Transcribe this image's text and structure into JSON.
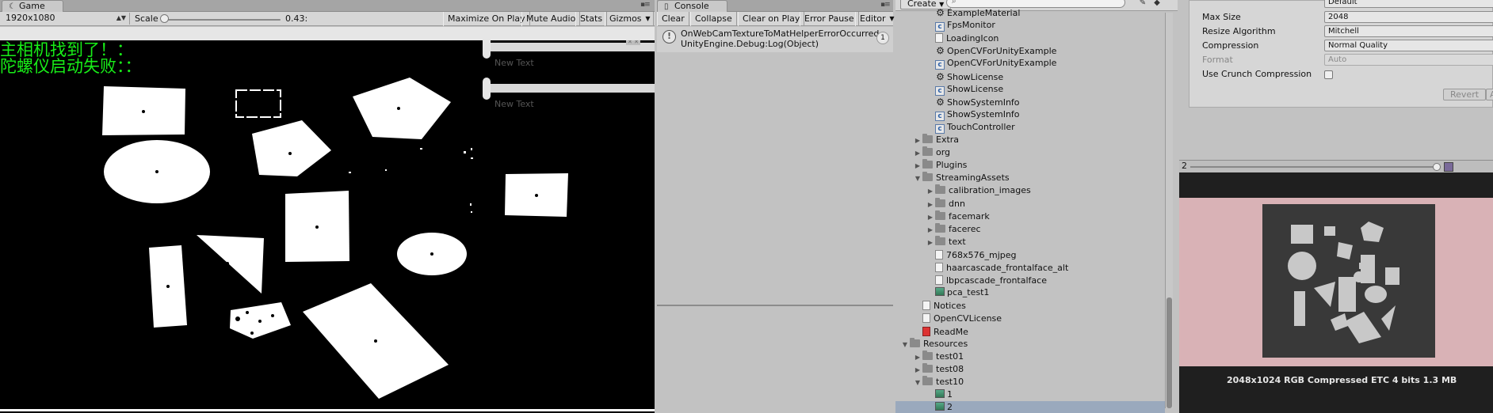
{
  "game": {
    "tab_label": "Game",
    "resolution": "1920x1080",
    "scale_label": "Scale",
    "scale_value": "0.43:",
    "buttons": [
      "Maximize On Play",
      "Mute Audio",
      "Stats",
      "Gizmos"
    ],
    "overlay_lines": [
      "主相机找到了！：",
      "陀螺仪启动失败：："
    ],
    "input_placeholders": [
      "New Text",
      "New Text"
    ]
  },
  "console": {
    "tab_label": "Console",
    "buttons": [
      "Clear",
      "Collapse",
      "Clear on Play",
      "Error Pause",
      "Editor"
    ],
    "entry": {
      "line1": "OnWebCamTextureToMatHelperErrorOccurred",
      "line2": "UnityEngine.Debug:Log(Object)",
      "count": "1"
    }
  },
  "project": {
    "create_label": "Create",
    "search_placeholder": "",
    "rows": [
      {
        "label": "ExampleMaterial",
        "icon": "unity",
        "indent": 2
      },
      {
        "label": "FpsMonitor",
        "icon": "cs",
        "indent": 2
      },
      {
        "label": "LoadingIcon",
        "icon": "file",
        "indent": 2
      },
      {
        "label": "OpenCVForUnityExample",
        "icon": "unity",
        "indent": 2
      },
      {
        "label": "OpenCVForUnityExample",
        "icon": "cs",
        "indent": 2
      },
      {
        "label": "ShowLicense",
        "icon": "unity",
        "indent": 2
      },
      {
        "label": "ShowLicense",
        "icon": "cs",
        "indent": 2
      },
      {
        "label": "ShowSystemInfo",
        "icon": "unity",
        "indent": 2
      },
      {
        "label": "ShowSystemInfo",
        "icon": "cs",
        "indent": 2
      },
      {
        "label": "TouchController",
        "icon": "cs",
        "indent": 2
      },
      {
        "label": "Extra",
        "icon": "folder",
        "indent": 1,
        "arrow": "▶"
      },
      {
        "label": "org",
        "icon": "folder",
        "indent": 1,
        "arrow": "▶"
      },
      {
        "label": "Plugins",
        "icon": "folder",
        "indent": 1,
        "arrow": "▶"
      },
      {
        "label": "StreamingAssets",
        "icon": "folder",
        "indent": 1,
        "arrow": "▼"
      },
      {
        "label": "calibration_images",
        "icon": "folder",
        "indent": 2,
        "arrow": "▶"
      },
      {
        "label": "dnn",
        "icon": "folder",
        "indent": 2,
        "arrow": "▶"
      },
      {
        "label": "facemark",
        "icon": "folder",
        "indent": 2,
        "arrow": "▶"
      },
      {
        "label": "facerec",
        "icon": "folder",
        "indent": 2,
        "arrow": "▶"
      },
      {
        "label": "text",
        "icon": "folder",
        "indent": 2,
        "arrow": "▶"
      },
      {
        "label": "768x576_mjpeg",
        "icon": "file",
        "indent": 2
      },
      {
        "label": "haarcascade_frontalface_alt",
        "icon": "file",
        "indent": 2
      },
      {
        "label": "lbpcascade_frontalface",
        "icon": "file",
        "indent": 2
      },
      {
        "label": "pca_test1",
        "icon": "img",
        "indent": 2
      },
      {
        "label": "Notices",
        "icon": "file",
        "indent": 1
      },
      {
        "label": "OpenCVLicense",
        "icon": "file",
        "indent": 1
      },
      {
        "label": "ReadMe",
        "icon": "pdf",
        "indent": 1
      },
      {
        "label": "Resources",
        "icon": "folder",
        "indent": 0,
        "arrow": "▼"
      },
      {
        "label": "test01",
        "icon": "folder",
        "indent": 1,
        "arrow": "▶"
      },
      {
        "label": "test08",
        "icon": "folder",
        "indent": 1,
        "arrow": "▶"
      },
      {
        "label": "test10",
        "icon": "folder",
        "indent": 1,
        "arrow": "▼"
      },
      {
        "label": "1",
        "icon": "img",
        "indent": 2
      },
      {
        "label": "2",
        "icon": "img",
        "indent": 2,
        "selected": true
      }
    ]
  },
  "inspector": {
    "top_value": "Default",
    "props": [
      {
        "label": "Max Size",
        "value": "2048",
        "type": "select"
      },
      {
        "label": "Resize Algorithm",
        "value": "Mitchell",
        "type": "select"
      },
      {
        "label": "Compression",
        "value": "Normal Quality",
        "type": "select"
      },
      {
        "label": "Format",
        "value": "Auto",
        "type": "select",
        "disabled": true
      },
      {
        "label": "Use Crunch Compression",
        "value": "",
        "type": "checkbox"
      }
    ],
    "revert_label": "Revert",
    "apply_label": "A",
    "preview_label": "2",
    "preview_info": "2048x1024  RGB Compressed ETC 4 bits   1.3 MB"
  }
}
